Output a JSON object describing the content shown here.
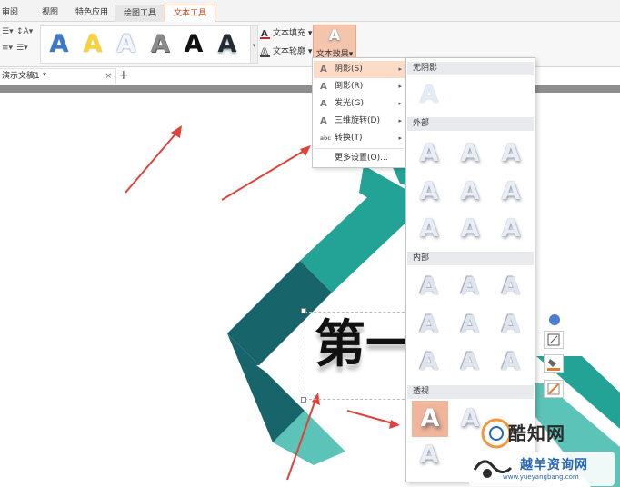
{
  "tabs": {
    "review": "审阅",
    "view": "视图",
    "special_apps": "特色应用",
    "drawing_tools": "绘图工具",
    "text_tools": "文本工具"
  },
  "ribbon": {
    "gallery_glyph": "A",
    "text_fill": "文本填充",
    "text_outline": "文本轮廓",
    "text_effect": "文本效果",
    "dropdown": "▾",
    "effect_glyph": "A"
  },
  "document": {
    "tab_label": "演示文稿1 *",
    "close": "×",
    "add": "+",
    "title_text": "第一"
  },
  "effect_menu": {
    "items": [
      {
        "label": "阴影(S)",
        "icon": "A",
        "has_submenu": true
      },
      {
        "label": "倒影(R)",
        "icon": "A",
        "has_submenu": true
      },
      {
        "label": "发光(G)",
        "icon": "A",
        "has_submenu": true
      },
      {
        "label": "三维旋转(D)",
        "icon": "A",
        "has_submenu": true
      },
      {
        "label": "转换(T)",
        "icon": "abc",
        "has_submenu": true
      },
      {
        "label": "更多设置(O)...",
        "icon": "",
        "has_submenu": false
      }
    ],
    "arrow": "▸"
  },
  "shadow_panel": {
    "no_shadow": "无阴影",
    "outer": "外部",
    "inner": "内部",
    "perspective": "透视",
    "glyph": "A"
  },
  "watermark": {
    "brand": "酷知网",
    "brand2": "越羊资询网",
    "url": "www.yueyangbang.com"
  },
  "colors": {
    "accent_tab": "#c4461c",
    "highlight": "#fcdcc6",
    "teal_dark": "#17656a",
    "teal_mid": "#23a396",
    "teal_light": "#5cc3b8",
    "arrow_red": "#e2413a"
  }
}
